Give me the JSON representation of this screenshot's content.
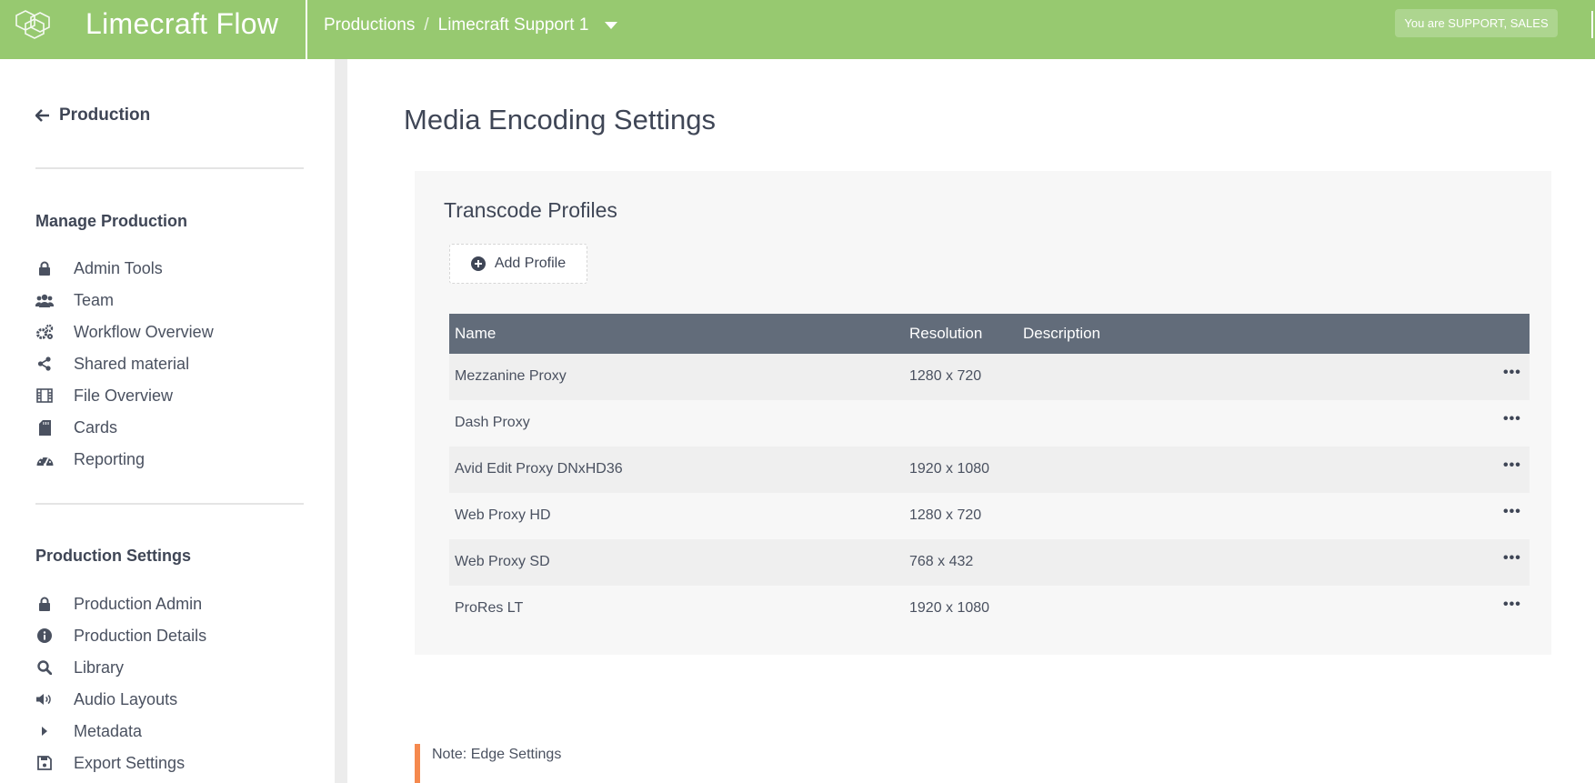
{
  "header": {
    "brand": "Limecraft Flow",
    "breadcrumb_root": "Productions",
    "breadcrumb_sep": "/",
    "breadcrumb_current": "Limecraft Support 1",
    "role_badge": "You are SUPPORT, SALES"
  },
  "sidebar": {
    "back_label": "Production",
    "manage_title": "Manage Production",
    "manage_items": [
      {
        "label": "Admin Tools",
        "icon": "lock-icon"
      },
      {
        "label": "Team",
        "icon": "users-icon"
      },
      {
        "label": "Workflow Overview",
        "icon": "cogs-icon"
      },
      {
        "label": "Shared material",
        "icon": "share-icon"
      },
      {
        "label": "File Overview",
        "icon": "film-icon"
      },
      {
        "label": "Cards",
        "icon": "sd-card-icon"
      },
      {
        "label": "Reporting",
        "icon": "dashboard-icon"
      }
    ],
    "settings_title": "Production Settings",
    "settings_items": [
      {
        "label": "Production Admin",
        "icon": "lock-icon"
      },
      {
        "label": "Production Details",
        "icon": "info-icon"
      },
      {
        "label": "Library",
        "icon": "search-icon"
      },
      {
        "label": "Audio Layouts",
        "icon": "volume-icon"
      },
      {
        "label": "Metadata",
        "icon": "caret-right-icon"
      },
      {
        "label": "Export Settings",
        "icon": "save-icon"
      }
    ]
  },
  "main": {
    "title": "Media Encoding Settings",
    "panel_title": "Transcode Profiles",
    "add_button": "Add Profile",
    "columns": [
      "Name",
      "Resolution",
      "Description"
    ],
    "rows": [
      {
        "name": "Mezzanine Proxy",
        "resolution": "1280 x 720",
        "description": ""
      },
      {
        "name": "Dash Proxy",
        "resolution": "",
        "description": ""
      },
      {
        "name": "Avid Edit Proxy DNxHD36",
        "resolution": "1920 x 1080",
        "description": ""
      },
      {
        "name": "Web Proxy HD",
        "resolution": "1280 x 720",
        "description": ""
      },
      {
        "name": "Web Proxy SD",
        "resolution": "768 x 432",
        "description": ""
      },
      {
        "name": "ProRes LT",
        "resolution": "1920 x 1080",
        "description": ""
      }
    ],
    "row_menu": "•••",
    "note": "Note: Edge Settings"
  },
  "colors": {
    "header": "#97c970",
    "table_header": "#626c7a",
    "note_accent": "#f5894e"
  }
}
